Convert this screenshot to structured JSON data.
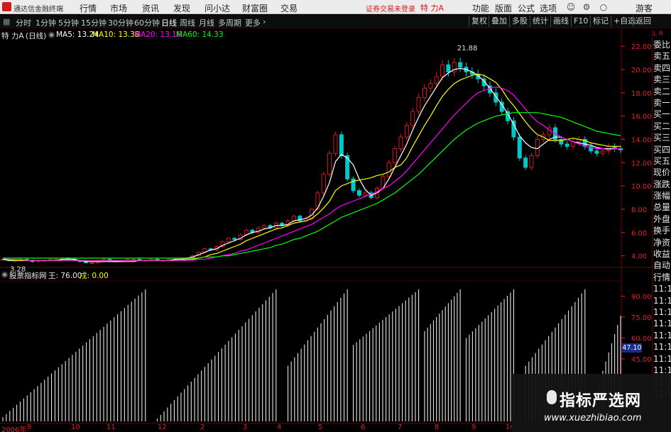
{
  "app": {
    "title": "通达信金融终端",
    "menu": [
      "行情",
      "市场",
      "资讯",
      "发现",
      "问小达",
      "财富圈",
      "交易"
    ],
    "status_text": "证券交易未登录",
    "stock_name": "特 力A",
    "right_menu": [
      "功能",
      "版面",
      "公式",
      "选项"
    ],
    "right_icons": [
      "user-icon",
      "gear-icon"
    ],
    "guest_label": "游客",
    "colors": {
      "up": "#d21b1b",
      "down": "#00c8c8",
      "ma5": "#ffffff",
      "ma10": "#ffff00",
      "ma20": "#ff00ff",
      "ma60": "#00ff00",
      "accent": "#d21b1b"
    }
  },
  "toolbar": {
    "periods": [
      "分时",
      "1分钟",
      "5分钟",
      "15分钟",
      "30分钟",
      "60分钟",
      "日线",
      "周线",
      "月线",
      "多周期",
      "更多"
    ],
    "active_period": "日线",
    "right_buttons": [
      "复权",
      "叠加",
      "多股",
      "统计",
      "画线",
      "F10",
      "标记",
      "+自选",
      "返回"
    ]
  },
  "legend": {
    "stock": "特 力A",
    "period": "(日线)",
    "ma5": "MA5: 13.24",
    "ma10": "MA10: 13.38",
    "ma20": "MA20: 13.16",
    "ma60": "MA60: 14.33"
  },
  "chart_main": {
    "y_ticks": [
      "22.00",
      "20.00",
      "18.00",
      "16.00",
      "14.00",
      "12.00",
      "10.00",
      "8.00",
      "6.00",
      "4.00"
    ],
    "high_label": "21.88",
    "low_label": "3.28"
  },
  "indicator": {
    "name": "股票指标网",
    "wang": "王: 76.00",
    "xu": "戌: 0.00",
    "y_ticks": [
      "90.00",
      "75.00",
      "60.00",
      "45.00"
    ],
    "readout": "47.10"
  },
  "quote_col": {
    "header": "L R",
    "items": [
      "委比",
      "卖五",
      "卖四",
      "卖三",
      "卖二",
      "卖一",
      "买一",
      "买二",
      "买三",
      "买四",
      "买五",
      "现价",
      "涨跌",
      "涨幅",
      "总量",
      "外盘",
      "换手",
      "净资",
      "收益",
      "自动",
      "行情",
      "11:1",
      "11:1",
      "11:1",
      "11:1",
      "11:1",
      "11:1",
      "11:1",
      "11:1",
      "11:1",
      "11:1"
    ]
  },
  "date_axis": [
    "2006年",
    "9",
    "10",
    "11",
    "12",
    "2",
    "3",
    "4",
    "5",
    "6",
    "7",
    "8",
    "9",
    "10"
  ],
  "watermark": {
    "title": "指标严选网",
    "url": "www.xuezhibiao.com"
  },
  "chart_data": {
    "type": "line",
    "title": "特 力A (日线)",
    "ylim": [
      3,
      22.5
    ],
    "price_series": [
      3.7,
      3.6,
      3.6,
      3.7,
      3.6,
      3.5,
      3.6,
      3.6,
      3.7,
      3.7,
      3.8,
      3.7,
      3.6,
      3.5,
      3.4,
      3.4,
      3.6,
      3.7,
      3.6,
      3.5,
      3.6,
      3.7,
      3.7,
      3.6,
      3.6,
      3.7,
      3.6,
      3.6,
      3.7,
      3.7,
      3.8,
      3.8,
      4.0,
      4.3,
      4.6,
      4.5,
      4.8,
      5.2,
      5.5,
      5.4,
      5.8,
      6.2,
      6.0,
      6.4,
      6.6,
      6.4,
      6.8,
      6.6,
      7.0,
      7.4,
      7.0,
      7.2,
      8.0,
      9.4,
      11.0,
      12.8,
      14.4,
      12.6,
      10.6,
      9.6,
      9.2,
      9.4,
      9.0,
      9.8,
      10.8,
      12.0,
      13.2,
      14.2,
      15.2,
      16.4,
      17.6,
      18.4,
      18.8,
      19.4,
      20.4,
      19.8,
      20.6,
      20.2,
      19.8,
      19.6,
      19.2,
      18.6,
      18.0,
      17.2,
      16.4,
      15.6,
      14.2,
      12.4,
      11.6,
      12.6,
      14.0,
      14.4,
      15.0,
      14.0,
      13.6,
      13.4,
      13.8,
      14.0,
      13.4,
      13.0,
      12.8,
      13.0,
      13.4,
      13.2,
      13.1
    ],
    "series": [
      {
        "name": "MA5",
        "values": [
          3.7,
          3.6,
          3.6,
          3.6,
          3.6,
          3.6,
          3.6,
          3.6,
          3.6,
          3.6,
          3.7,
          3.7,
          3.7,
          3.6,
          3.5,
          3.5,
          3.5,
          3.5,
          3.5,
          3.5,
          3.6,
          3.6,
          3.6,
          3.6,
          3.6,
          3.6,
          3.6,
          3.6,
          3.6,
          3.7,
          3.7,
          3.8,
          3.9,
          4.1,
          4.3,
          4.5,
          4.6,
          4.9,
          5.1,
          5.3,
          5.5,
          5.8,
          6.0,
          6.1,
          6.3,
          6.4,
          6.6,
          6.6,
          6.7,
          7.0,
          7.1,
          7.2,
          7.5,
          8.1,
          9.1,
          10.3,
          12.1,
          12.7,
          12.4,
          11.8,
          10.6,
          9.7,
          9.2,
          9.4,
          9.8,
          10.6,
          11.6,
          12.6,
          13.6,
          14.8,
          15.9,
          16.9,
          17.7,
          18.5,
          19.3,
          19.7,
          20.0,
          20.1,
          20.0,
          19.8,
          19.5,
          19.0,
          18.4,
          17.7,
          17.0,
          16.2,
          15.3,
          14.3,
          13.7,
          13.3,
          13.2,
          13.6,
          14.0,
          14.2,
          14.2,
          14.0,
          13.8,
          13.7,
          13.6,
          13.5,
          13.3,
          13.2,
          13.2,
          13.2,
          13.2
        ]
      },
      {
        "name": "MA10",
        "values": [
          3.7,
          3.7,
          3.6,
          3.6,
          3.6,
          3.6,
          3.6,
          3.6,
          3.6,
          3.6,
          3.6,
          3.6,
          3.6,
          3.6,
          3.6,
          3.6,
          3.6,
          3.6,
          3.6,
          3.5,
          3.5,
          3.5,
          3.5,
          3.6,
          3.6,
          3.6,
          3.6,
          3.6,
          3.6,
          3.6,
          3.6,
          3.7,
          3.7,
          3.8,
          3.9,
          4.1,
          4.2,
          4.4,
          4.6,
          4.8,
          5.0,
          5.3,
          5.5,
          5.7,
          5.9,
          6.1,
          6.3,
          6.4,
          6.6,
          6.8,
          6.9,
          7.0,
          7.2,
          7.6,
          8.1,
          8.7,
          9.6,
          10.0,
          10.2,
          10.4,
          10.5,
          10.6,
          10.7,
          10.9,
          11.0,
          11.2,
          11.6,
          11.8,
          12.4,
          13.4,
          14.3,
          15.2,
          16.0,
          16.9,
          17.7,
          18.3,
          18.8,
          19.1,
          19.3,
          19.5,
          19.6,
          19.5,
          19.2,
          18.9,
          18.3,
          17.5,
          16.9,
          16.2,
          15.5,
          14.9,
          14.4,
          14.2,
          13.9,
          13.9,
          13.9,
          14.0,
          14.1,
          14.0,
          13.9,
          13.7,
          13.6,
          13.5,
          13.4,
          13.4,
          13.4
        ]
      },
      {
        "name": "MA20",
        "values": [
          3.8,
          3.7,
          3.7,
          3.7,
          3.6,
          3.6,
          3.6,
          3.6,
          3.6,
          3.6,
          3.6,
          3.6,
          3.6,
          3.6,
          3.6,
          3.6,
          3.6,
          3.6,
          3.6,
          3.6,
          3.6,
          3.6,
          3.6,
          3.6,
          3.6,
          3.6,
          3.6,
          3.6,
          3.6,
          3.6,
          3.6,
          3.6,
          3.6,
          3.7,
          3.7,
          3.8,
          3.9,
          4.0,
          4.1,
          4.2,
          4.4,
          4.5,
          4.7,
          4.9,
          5.1,
          5.3,
          5.5,
          5.7,
          5.9,
          6.1,
          6.3,
          6.5,
          6.7,
          7.0,
          7.3,
          7.6,
          8.0,
          8.3,
          8.5,
          8.7,
          8.9,
          9.1,
          9.3,
          9.5,
          9.8,
          10.0,
          10.4,
          10.8,
          11.3,
          11.9,
          12.5,
          13.1,
          13.7,
          14.3,
          14.9,
          15.5,
          16.1,
          16.6,
          17.1,
          17.6,
          18.0,
          18.2,
          18.4,
          18.5,
          18.4,
          18.2,
          17.8,
          17.2,
          16.6,
          16.0,
          15.5,
          15.2,
          14.8,
          14.5,
          14.2,
          14.0,
          13.8,
          13.6,
          13.4,
          13.3,
          13.2,
          13.2,
          13.1,
          13.2,
          13.2
        ]
      },
      {
        "name": "MA60",
        "values": [
          3.8,
          3.8,
          3.8,
          3.8,
          3.8,
          3.8,
          3.8,
          3.8,
          3.8,
          3.8,
          3.8,
          3.8,
          3.8,
          3.8,
          3.8,
          3.8,
          3.8,
          3.8,
          3.8,
          3.8,
          3.8,
          3.8,
          3.8,
          3.8,
          3.8,
          3.8,
          3.8,
          3.8,
          3.8,
          3.8,
          3.8,
          3.8,
          3.8,
          3.8,
          3.9,
          3.9,
          3.9,
          4.0,
          4.0,
          4.1,
          4.2,
          4.3,
          4.4,
          4.5,
          4.6,
          4.7,
          4.9,
          5.0,
          5.2,
          5.4,
          5.5,
          5.7,
          5.9,
          6.1,
          6.4,
          6.7,
          7.0,
          7.3,
          7.5,
          7.7,
          7.9,
          8.1,
          8.3,
          8.5,
          8.8,
          9.1,
          9.4,
          9.8,
          10.2,
          10.6,
          11.0,
          11.5,
          12.0,
          12.5,
          13.0,
          13.5,
          14.0,
          14.4,
          14.8,
          15.1,
          15.4,
          15.6,
          15.8,
          16.0,
          16.1,
          16.2,
          16.3,
          16.3,
          16.3,
          16.3,
          16.3,
          16.2,
          16.1,
          16.0,
          15.9,
          15.7,
          15.5,
          15.3,
          15.1,
          14.9,
          14.7,
          14.6,
          14.5,
          14.4,
          14.33
        ]
      }
    ],
    "indicator": {
      "name": "股票指标网",
      "ylim": [
        0,
        100
      ],
      "cycles": [
        [
          0,
          24,
          3,
          95
        ],
        [
          26,
          46,
          2,
          95
        ],
        [
          48,
          58,
          40,
          95
        ],
        [
          59,
          70,
          55,
          95
        ],
        [
          71,
          77,
          65,
          95
        ],
        [
          78,
          86,
          60,
          95
        ],
        [
          88,
          98,
          40,
          95
        ],
        [
          99,
          104,
          10,
          76
        ]
      ]
    }
  }
}
